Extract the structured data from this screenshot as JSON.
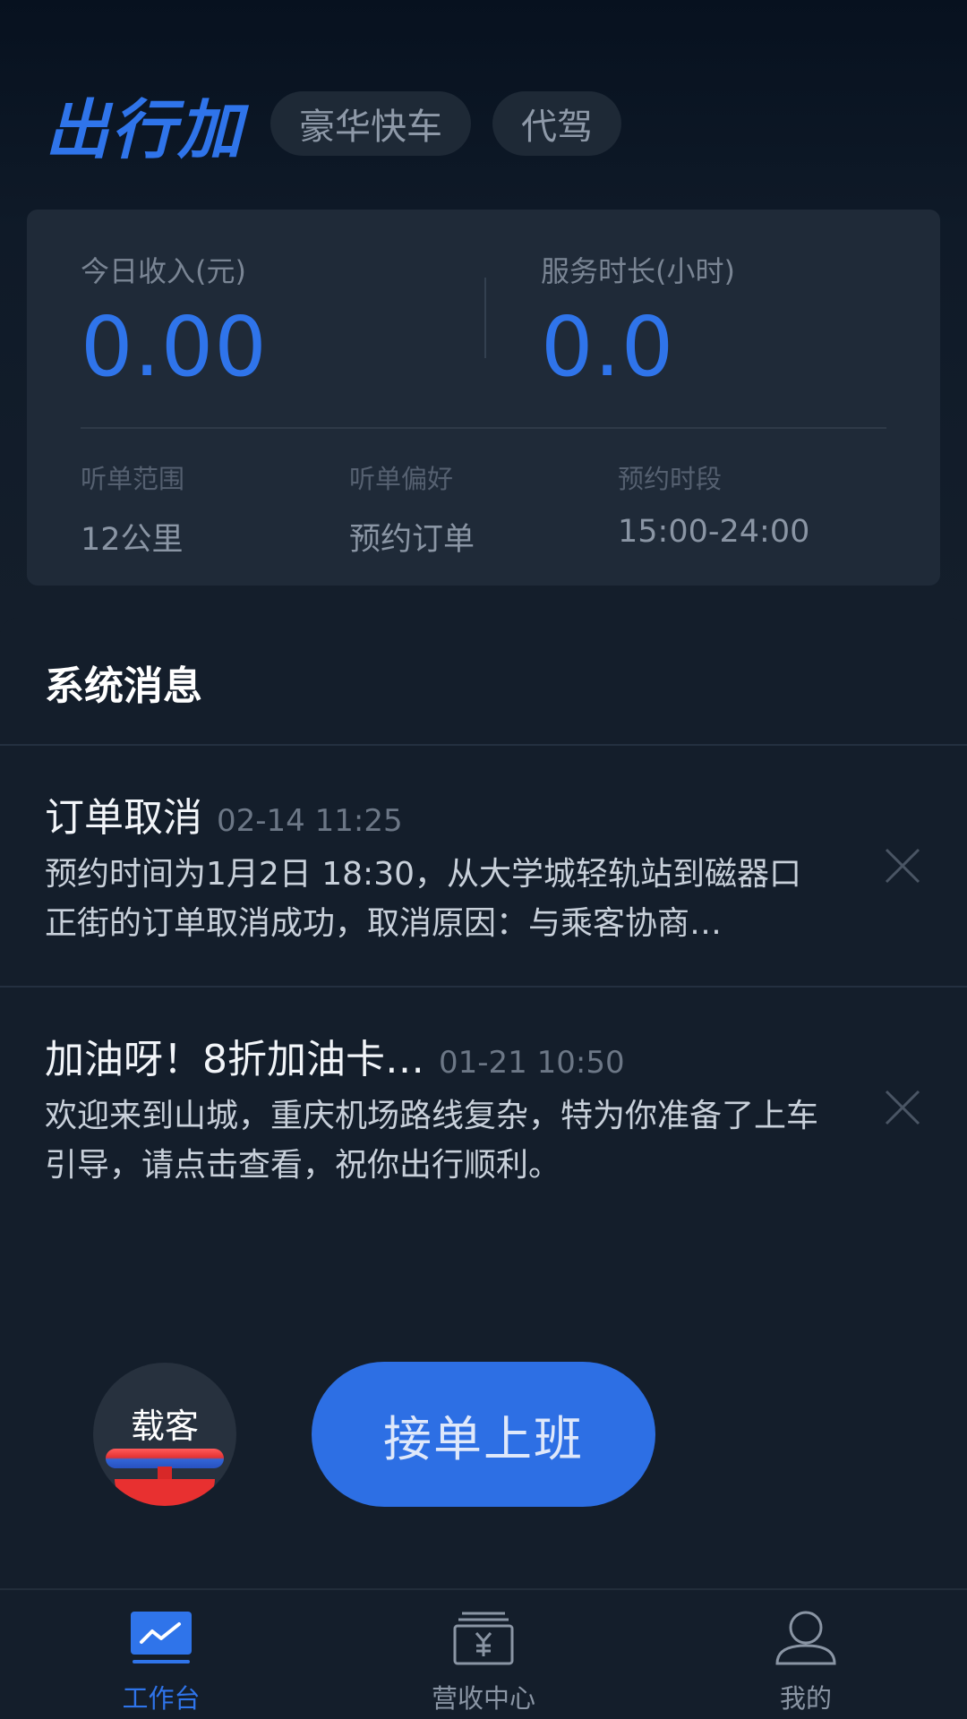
{
  "header": {
    "logo": "出行加",
    "chips": [
      "豪华快车",
      "代驾"
    ]
  },
  "stats": {
    "income_label": "今日收入(元)",
    "income_value": "0.00",
    "duration_label": "服务时长(小时)",
    "duration_value": "0.0"
  },
  "preferences": [
    {
      "label": "听单范围",
      "value": "12公里"
    },
    {
      "label": "听单偏好",
      "value": "预约订单"
    },
    {
      "label": "预约时段",
      "value": "15:00-24:00"
    }
  ],
  "messages": {
    "title": "系统消息",
    "items": [
      {
        "title": "订单取消",
        "time": "02-14 11:25",
        "body": "预约时间为1月2日 18:30，从大学城轻轨站到磁器口正街的订单取消成功，取消原因：与乘客协商…"
      },
      {
        "title": "加油呀！8折加油卡…",
        "time": "01-21 10:50",
        "body": "欢迎来到山城，重庆机场路线复杂，特为你准备了上车引导，请点击查看，祝你出行顺利。"
      }
    ]
  },
  "actions": {
    "carry_label": "载客",
    "start_label": "接单上班"
  },
  "tabbar": [
    {
      "label": "工作台",
      "icon": "dashboard-icon",
      "active": true
    },
    {
      "label": "营收中心",
      "icon": "revenue-icon",
      "active": false
    },
    {
      "label": "我的",
      "icon": "profile-icon",
      "active": false
    }
  ],
  "colors": {
    "accent": "#2f74ea",
    "background": "#141e2b",
    "card": "#1f2a38"
  }
}
